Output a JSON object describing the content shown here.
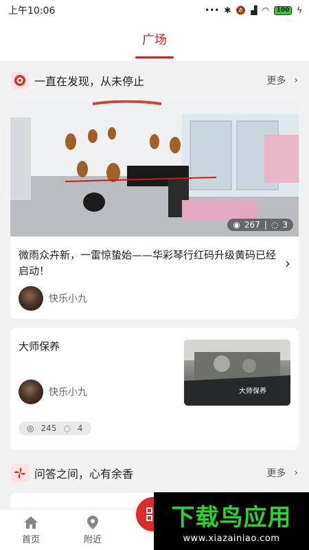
{
  "status_bar": {
    "time": "上午10:06",
    "battery": "100"
  },
  "header": {
    "tab": "广场"
  },
  "section1": {
    "title": "一直在发现，从未停止",
    "more": "更多"
  },
  "article1": {
    "views": "267",
    "comments": "3",
    "title": "微雨众卉新，一雷惊蛰始——华彩琴行红码升级黄码已经启动！",
    "author": "快乐小九"
  },
  "article2": {
    "title": "大师保养",
    "author": "快乐小九",
    "views": "245",
    "comments": "4",
    "thumb_text": "大师保养"
  },
  "section2": {
    "title": "问答之间，心有余香",
    "more": "更多"
  },
  "nav": {
    "home": "首页",
    "nearby": "附近"
  },
  "watermark": {
    "title": "下载鸟应用",
    "url": "www.xiazainiao.com"
  },
  "colors": {
    "accent": "#d42020",
    "watermark_green": "#2bd62b"
  }
}
